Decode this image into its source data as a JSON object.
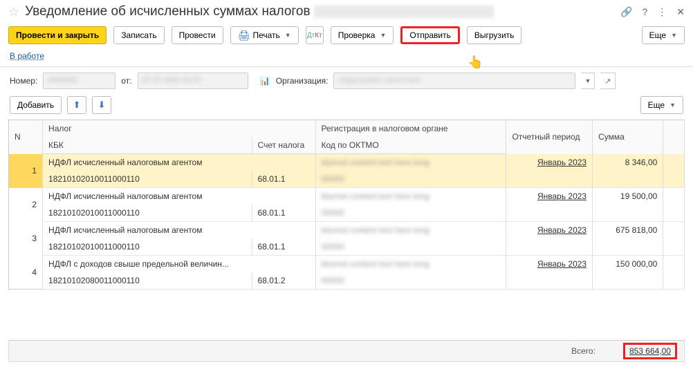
{
  "header": {
    "title": "Уведомление об исчисленных суммах налогов"
  },
  "toolbar": {
    "post_close": "Провести и закрыть",
    "write": "Записать",
    "post": "Провести",
    "print": "Печать",
    "check": "Проверка",
    "send": "Отправить",
    "export": "Выгрузить",
    "more": "Еще"
  },
  "status": {
    "label": "В работе"
  },
  "form": {
    "number_label": "Номер:",
    "from_label": "от:",
    "org_label": "Организация:"
  },
  "actions": {
    "add": "Добавить",
    "more": "Еще"
  },
  "columns": {
    "n": "N",
    "tax": "Налог",
    "kbk": "КБК",
    "acct": "Счет налога",
    "reg": "Регистрация в налоговом органе",
    "oktmo": "Код по ОКТМО",
    "period": "Отчетный период",
    "sum": "Сумма"
  },
  "rows": [
    {
      "n": "1",
      "tax": "НДФЛ исчисленный налоговым агентом",
      "kbk": "18210102010011000110",
      "acct": "68.01.1",
      "period": "Январь 2023",
      "sum": "8 346,00"
    },
    {
      "n": "2",
      "tax": "НДФЛ исчисленный налоговым агентом",
      "kbk": "18210102010011000110",
      "acct": "68.01.1",
      "period": "Январь 2023",
      "sum": "19 500,00"
    },
    {
      "n": "3",
      "tax": "НДФЛ исчисленный налоговым агентом",
      "kbk": "18210102010011000110",
      "acct": "68.01.1",
      "period": "Январь 2023",
      "sum": "675 818,00"
    },
    {
      "n": "4",
      "tax": "НДФЛ с доходов свыше предельной величин...",
      "kbk": "18210102080011000110",
      "acct": "68.01.2",
      "period": "Январь 2023",
      "sum": "150 000,00"
    }
  ],
  "total": {
    "label": "Всего:",
    "value": "853 664,00"
  }
}
